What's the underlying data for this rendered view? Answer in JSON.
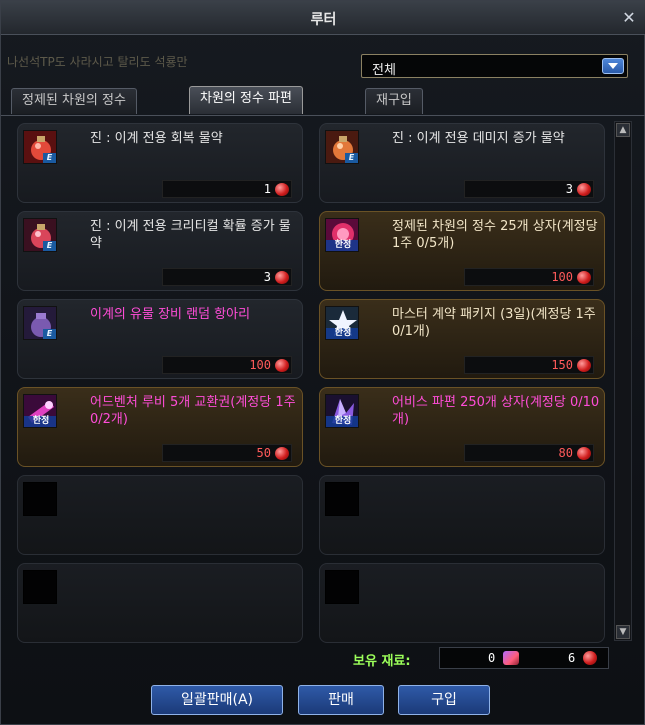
{
  "window": {
    "title": "루터",
    "close_icon": "close-icon"
  },
  "ghost_text": "나선석TP도 사라시고 탈리도 석룡만",
  "filter": {
    "selected": "전체"
  },
  "tabs": [
    {
      "label": "정제된 차원의 정수",
      "active": false
    },
    {
      "label": "차원의 정수 파편",
      "active": true
    },
    {
      "label": "재구입",
      "active": false
    }
  ],
  "items": [
    {
      "name": "진 : 이계 전용 회복 물약",
      "price": "1",
      "style": "normal",
      "icon": "potion-icon",
      "badge": "E"
    },
    {
      "name": "진 : 이계 전용 데미지 증가 물약",
      "price": "3",
      "style": "normal",
      "icon": "potion-icon",
      "badge": "E"
    },
    {
      "name": "진 : 이계 전용 크리티컬 확률 증가 물약",
      "price": "3",
      "style": "normal",
      "icon": "potion-icon",
      "badge": "E"
    },
    {
      "name": "정제된 차원의 정수 25개 상자(계정당 1주 0/5개)",
      "price": "100",
      "style": "gold",
      "icon": "essence-box-icon",
      "badge": "한정"
    },
    {
      "name": "이계의 유물 장비 랜덤 항아리",
      "price": "100",
      "style": "normal magenta",
      "icon": "jar-icon",
      "badge": "E"
    },
    {
      "name": "마스터 계약 패키지 (3일)(계정당 1주 0/1개)",
      "price": "150",
      "style": "gold",
      "icon": "contract-icon",
      "badge": "한정"
    },
    {
      "name": "어드벤처 루비 5개 교환권(계정당 1주 0/2개)",
      "price": "50",
      "style": "gold magenta",
      "icon": "ruby-ticket-icon",
      "badge": "한정"
    },
    {
      "name": "어비스 파편 250개 상자(계정당 0/10개)",
      "price": "80",
      "style": "gold magenta",
      "icon": "abyss-shard-icon",
      "badge": "한정"
    }
  ],
  "holdings": {
    "label": "보유 재료:",
    "value1": "0",
    "value2": "6"
  },
  "buttons": {
    "sell_all": "일괄판매(A)",
    "sell": "판매",
    "buy": "구입"
  },
  "colors": {
    "accent_blue": "#2f5aa8",
    "gold_border": "#6a5226",
    "magenta_text": "#ff4dd8",
    "price_red": "#ff5a5a"
  }
}
